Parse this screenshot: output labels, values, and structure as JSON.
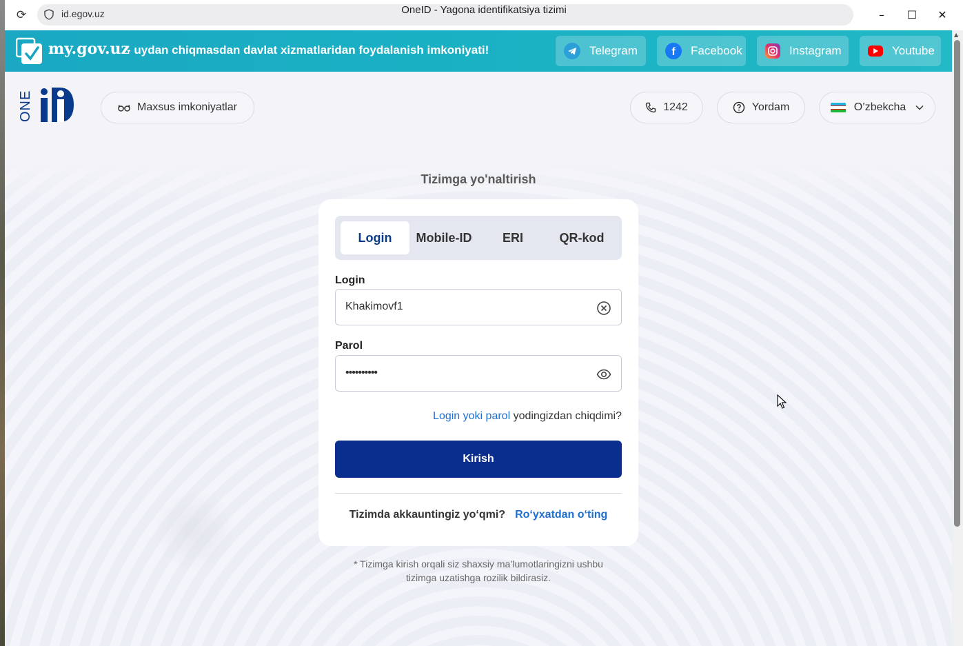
{
  "browser": {
    "url": "id.egov.uz",
    "title": "OneID - Yagona identifikatsiya tizimi"
  },
  "banner": {
    "site": "my.gov.uz",
    "tagline": "- uydan chiqmasdan davlat xizmatlaridan foydalanish imkoniyati!",
    "socials": [
      {
        "label": "Telegram",
        "icon": "telegram-icon",
        "color": "#2a9fd8"
      },
      {
        "label": "Facebook",
        "icon": "facebook-icon",
        "color": "#1877f2"
      },
      {
        "label": "Instagram",
        "icon": "instagram-icon",
        "color": "#e1306c"
      },
      {
        "label": "Youtube",
        "icon": "youtube-icon",
        "color": "#ff0000"
      }
    ]
  },
  "header": {
    "accessibility": "Maxsus imkoniyatlar",
    "phone": "1242",
    "help": "Yordam",
    "language": "O’zbekcha"
  },
  "login": {
    "heading": "Tizimga yo'naltirish",
    "tabs": [
      "Login",
      "Mobile-ID",
      "ERI",
      "QR-kod"
    ],
    "active_tab": "Login",
    "login_label": "Login",
    "login_value": "Khakimovf1",
    "password_label": "Parol",
    "password_value": "••••••••••",
    "forgot_link": "Login yoki parol",
    "forgot_rest": " yodingizdan chiqdimi?",
    "submit": "Kirish",
    "no_account": "Tizimda akkauntingiz yo‘qmi?",
    "register": "Ro‘yxatdan o‘ting",
    "consent_line1": "* Tizimga kirish orqali siz shaxsiy ma’lumotlaringizni ushbu",
    "consent_line2": "tizimga uzatishga rozilik bildirasiz."
  },
  "colors": {
    "primary": "#0a2e8e",
    "link": "#1f6fcf",
    "banner": "#1aa8c2"
  }
}
